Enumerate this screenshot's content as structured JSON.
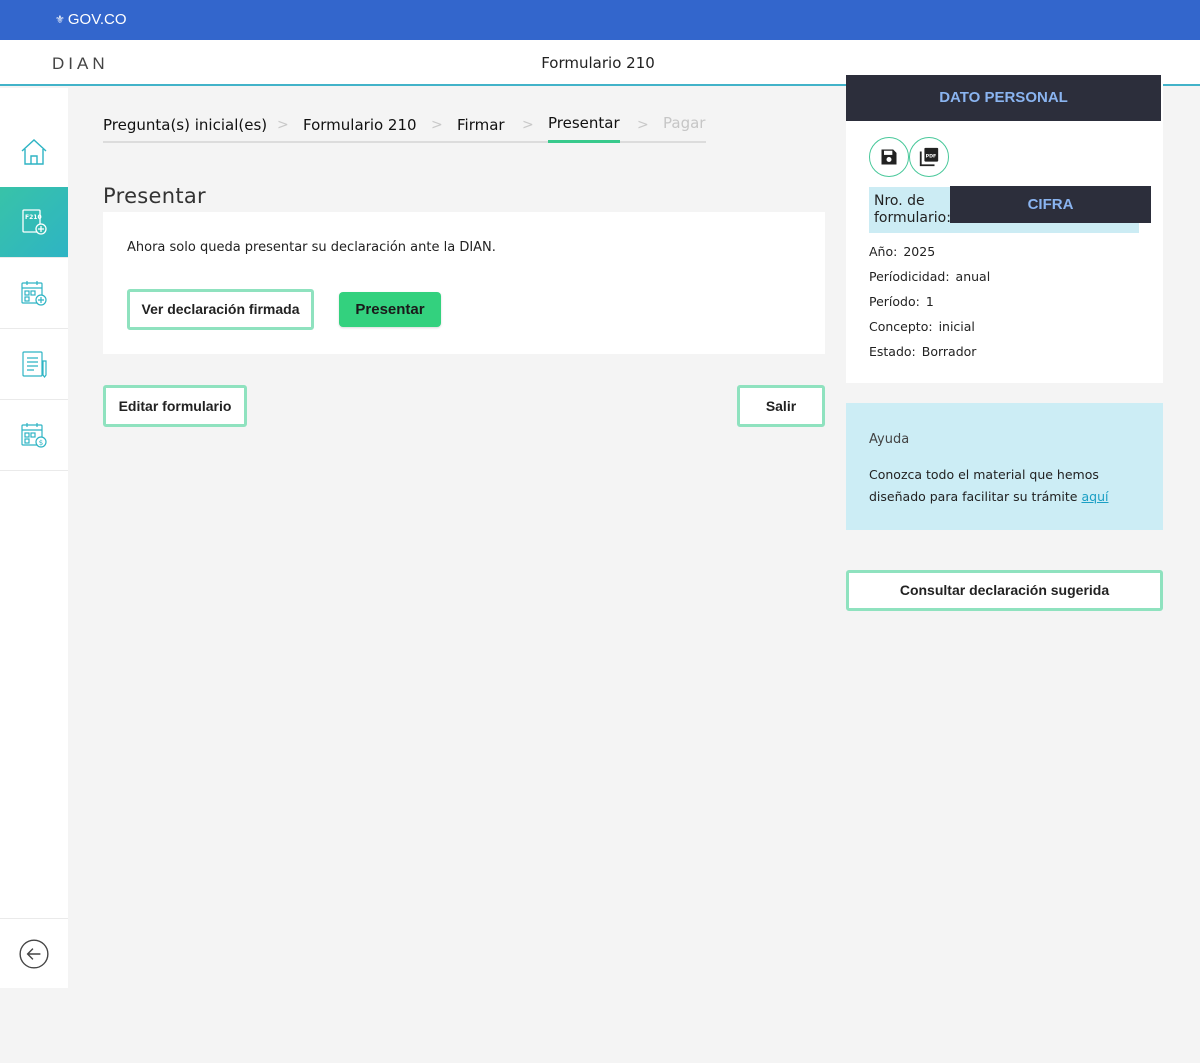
{
  "gov_bar": {
    "logo_text": "GOV.CO",
    "seal_glyph": "⚜"
  },
  "header": {
    "logo": "DIAN",
    "title": "Formulario 210"
  },
  "sidebar": {
    "items": [
      {
        "name": "home",
        "icon": "home-icon"
      },
      {
        "name": "form-210",
        "icon": "form-f210-add-icon",
        "active": true
      },
      {
        "name": "calendar-add",
        "icon": "calendar-add-icon"
      },
      {
        "name": "list-edit",
        "icon": "list-edit-icon"
      },
      {
        "name": "calendar-payment",
        "icon": "calendar-dollar-icon"
      }
    ],
    "back_icon": "arrow-left-circle-icon"
  },
  "stepper": {
    "steps": [
      {
        "label": "Pregunta(s) inicial(es)",
        "state": "done"
      },
      {
        "label": "Formulario 210",
        "state": "done"
      },
      {
        "label": "Firmar",
        "state": "done"
      },
      {
        "label": "Presentar",
        "state": "current"
      },
      {
        "label": "Pagar",
        "state": "disabled"
      }
    ]
  },
  "main": {
    "section_title": "Presentar",
    "message": "Ahora solo queda presentar su declaración ante la DIAN.",
    "view_button": "Ver declaración firmada",
    "present_button": "Presentar",
    "edit_button": "Editar formulario",
    "exit_button": "Salir"
  },
  "right_panel": {
    "header": "DATO PERSONAL",
    "save_icon": "save-icon",
    "pdf_icon": "pdf-icon",
    "form_number_label": "Nro. de formulario:",
    "form_number_value": "CIFRA",
    "info": [
      {
        "key": "Año:",
        "value": "2025"
      },
      {
        "key": "Períodicidad:",
        "value": "anual"
      },
      {
        "key": "Período:",
        "value": "1"
      },
      {
        "key": "Concepto:",
        "value": "inicial"
      },
      {
        "key": "Estado:",
        "value": "Borrador"
      }
    ]
  },
  "help": {
    "title": "Ayuda",
    "text": "Conozca todo el material que hemos diseñado para facilitar su trámite",
    "link": "aquí"
  },
  "consult_button": "Consultar declaración sugerida",
  "colors": {
    "gov_blue": "#3366cc",
    "accent_green": "#33d17e",
    "outline_green": "#8fe2bf",
    "teal": "#2eb4c4",
    "dark_header": "#2c2e3b",
    "help_bg": "#ccedf5"
  }
}
